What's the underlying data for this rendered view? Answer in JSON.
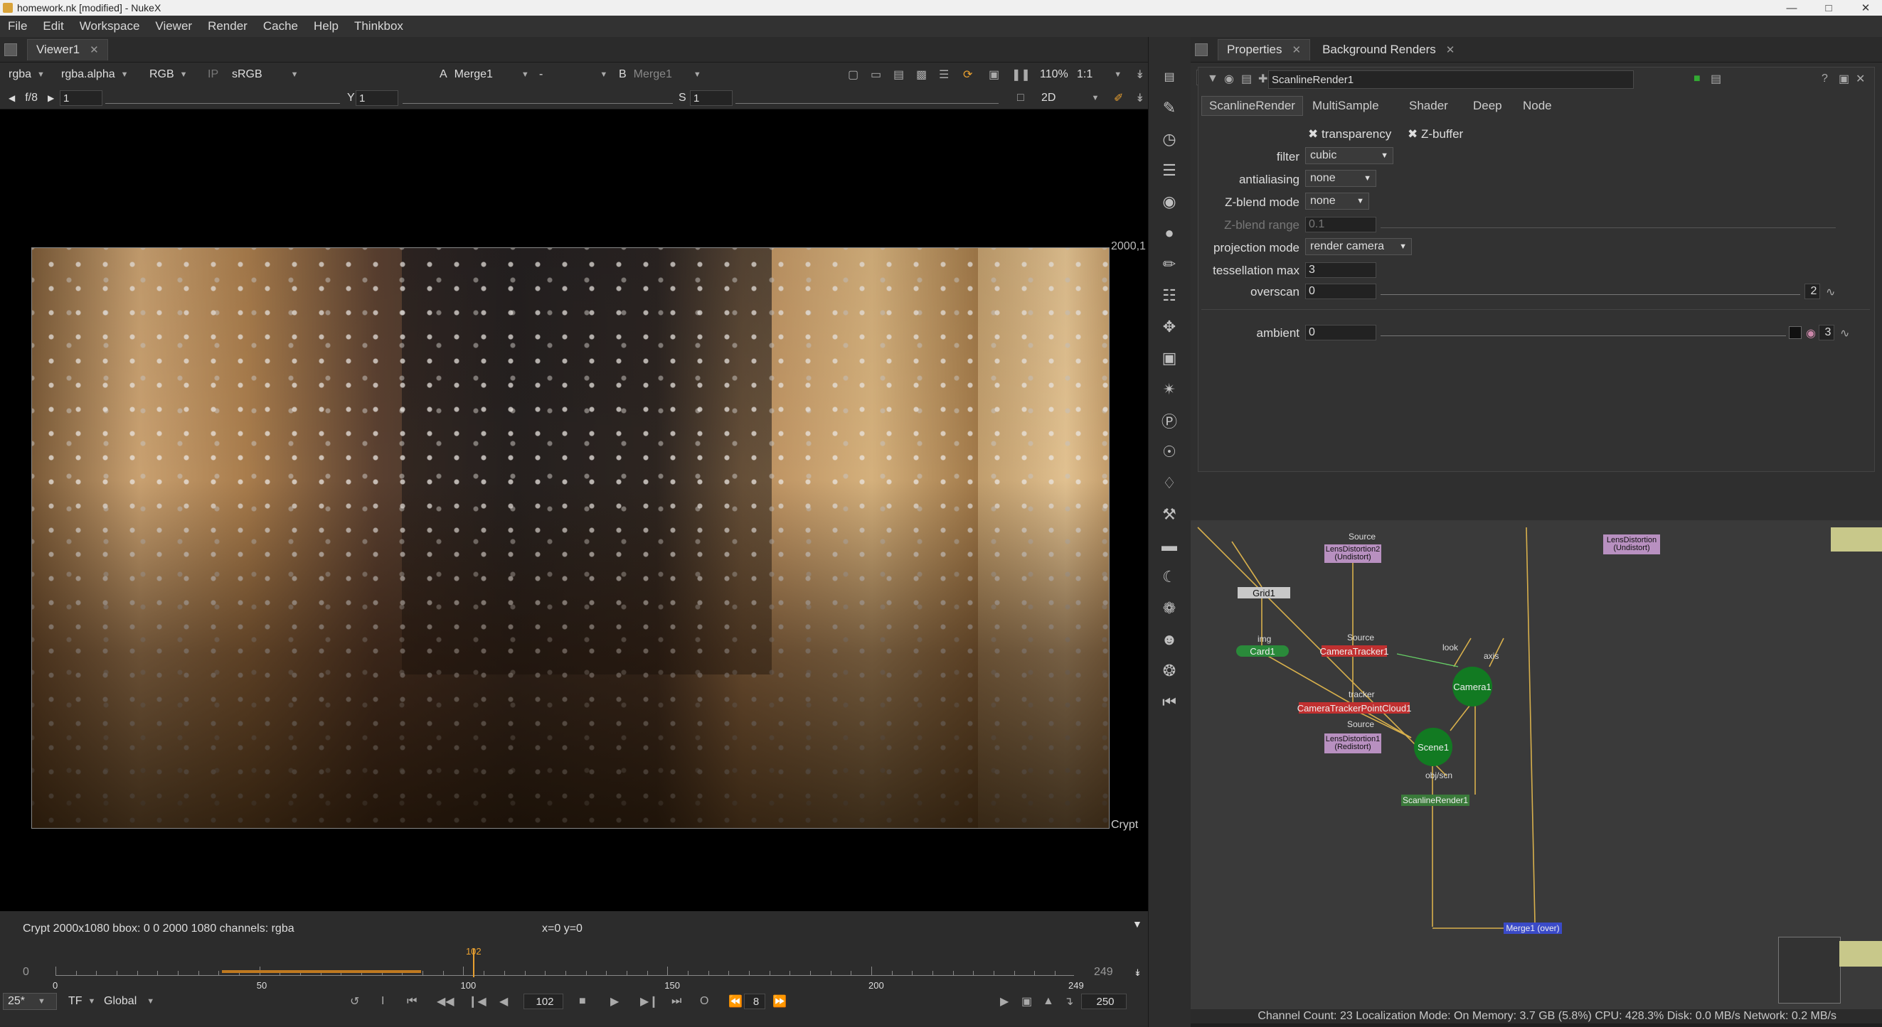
{
  "window": {
    "title": "homework.nk [modified] - NukeX"
  },
  "menu": [
    "File",
    "Edit",
    "Workspace",
    "Viewer",
    "Render",
    "Cache",
    "Help",
    "Thinkbox"
  ],
  "viewer": {
    "tab": "Viewer1",
    "channels": "rgba",
    "alpha": "rgba.alpha",
    "display": "RGB",
    "ip": "IP",
    "lut": "sRGB",
    "input_a_label": "A",
    "input_a": "Merge1",
    "dash": "-",
    "input_b_label": "B",
    "input_b": "Merge1",
    "zoom": "110%",
    "ratio": "1:1",
    "fstop": "f/8",
    "gain": "1",
    "gamma_label": "Y",
    "gamma": "1",
    "s_label": "S",
    "s_value": "1",
    "mode": "2D",
    "format_label": "2000,1",
    "crypt": "Crypt",
    "info": "Crypt 2000x1080  bbox: 0 0 2000 1080 channels: rgba",
    "coords": "x=0 y=0"
  },
  "timeline": {
    "start": "0",
    "end": "249",
    "current": "102",
    "ticks": [
      "0",
      "50",
      "100",
      "150",
      "200",
      "249"
    ],
    "fps": "25*",
    "tf": "TF",
    "scope": "Global",
    "frame": "102",
    "step": "8",
    "end_frame": "250"
  },
  "properties": {
    "tabs": [
      "Properties",
      "Background Renders"
    ],
    "node_number": "1",
    "node_name": "ScanlineRender1",
    "subtabs": [
      "ScanlineRender",
      "MultiSample",
      "Shader",
      "Deep",
      "Node"
    ],
    "transparency": "transparency",
    "zbuffer": "Z-buffer",
    "rows": [
      {
        "label": "filter",
        "value": "cubic"
      },
      {
        "label": "antialiasing",
        "value": "none"
      },
      {
        "label": "Z-blend mode",
        "value": "none"
      },
      {
        "label": "Z-blend range",
        "value": "0.1"
      },
      {
        "label": "projection mode",
        "value": "render camera"
      },
      {
        "label": "tessellation max",
        "value": "3"
      },
      {
        "label": "overscan",
        "value": "0"
      },
      {
        "label": "ambient",
        "value": "0"
      }
    ],
    "overscan_count": "2",
    "ambient_count": "3"
  },
  "nodes": [
    {
      "name": "LensDistortion2\n(Undistort)",
      "label": "Source"
    },
    {
      "name": "Grid1"
    },
    {
      "name": "Card1",
      "label": "img"
    },
    {
      "name": "CameraTracker1",
      "label": "Source"
    },
    {
      "name": "Camera1",
      "label_l": "look",
      "label_r": "axis"
    },
    {
      "name": "CameraTrackerPointCloud1",
      "label": "tracker"
    },
    {
      "name": "LensDistortion1\n(Redistort)",
      "label": "Source"
    },
    {
      "name": "Scene1"
    },
    {
      "name": "ScanlineRender1",
      "label": "obj/scn"
    },
    {
      "name": "LensDistortion\n(Undistort)"
    },
    {
      "name": "Merge1 (over)"
    }
  ],
  "status": "Channel Count: 23  Localization Mode: On  Memory: 3.7 GB (5.8%)  CPU: 428.3%  Disk: 0.0 MB/s  Network: 0.2 MB/s"
}
